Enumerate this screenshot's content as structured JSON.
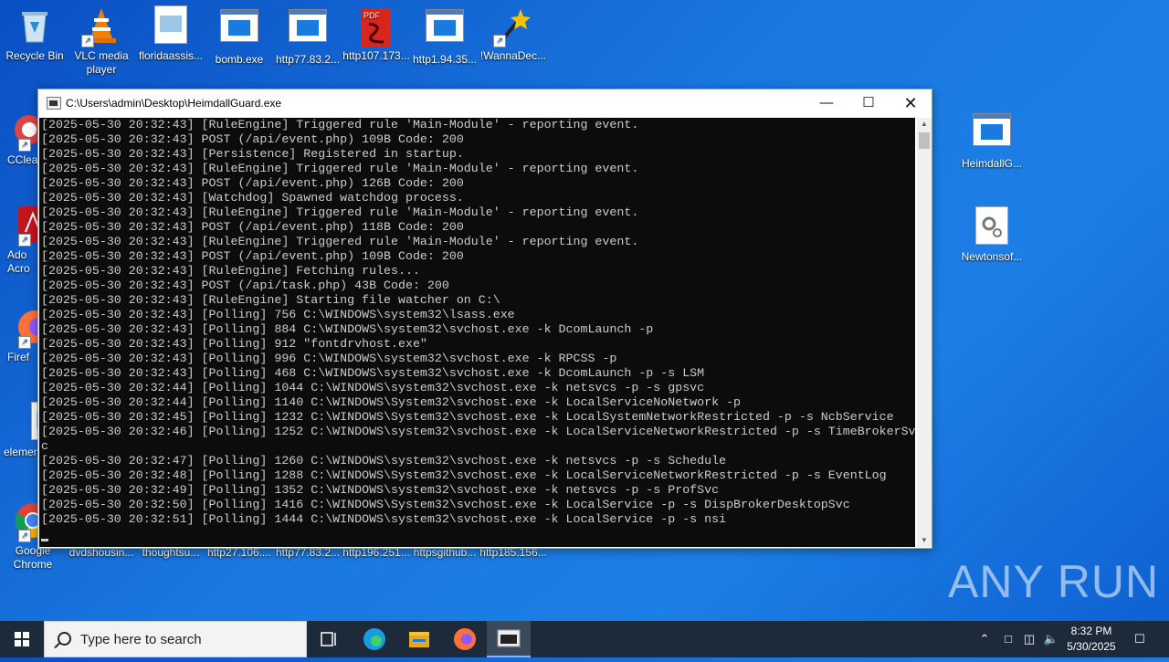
{
  "desktop_icons_top": [
    {
      "name": "recycle-bin-icon",
      "label": "Recycle Bin"
    },
    {
      "name": "vlc-icon",
      "label": "VLC media player"
    },
    {
      "name": "floridaassis-icon",
      "label": "floridaassis..."
    },
    {
      "name": "bomb-exe-icon",
      "label": "bomb.exe"
    },
    {
      "name": "http77-icon",
      "label": "http77.83.2..."
    },
    {
      "name": "http107-icon",
      "label": "http107.173..."
    },
    {
      "name": "http1-icon",
      "label": "http1.94.35..."
    },
    {
      "name": "wannadec-icon",
      "label": "!WannaDec..."
    }
  ],
  "desktop_icons_left": [
    {
      "name": "ccleaner-icon",
      "label": "CClea"
    },
    {
      "name": "adobe-icon",
      "label": "Ado Acro"
    },
    {
      "name": "firefox-desktop-icon",
      "label": "Firef"
    },
    {
      "name": "element-icon",
      "label": "elemen"
    },
    {
      "name": "chrome-icon",
      "label": "Google Chrome"
    }
  ],
  "desktop_icons_bottom": [
    {
      "name": "dvdshousin-icon",
      "label": "dvdshousin..."
    },
    {
      "name": "thoughtsu-icon",
      "label": "thoughtsu..."
    },
    {
      "name": "http27-icon",
      "label": "http27.106...."
    },
    {
      "name": "http77b-icon",
      "label": "http77.83.2..."
    },
    {
      "name": "http196-icon",
      "label": "http196.251..."
    },
    {
      "name": "httpsgithub-icon",
      "label": "httpsgithub..."
    },
    {
      "name": "http185-icon",
      "label": "http185.156..."
    }
  ],
  "desktop_icons_right": [
    {
      "name": "heimdall-desktop-icon",
      "label": "HeimdallG..."
    },
    {
      "name": "newtonsof-icon",
      "label": "Newtonsof..."
    }
  ],
  "console": {
    "title": "C:\\Users\\admin\\Desktop\\HeimdallGuard.exe",
    "lines": [
      "[2025-05-30 20:32:43] [RuleEngine] Triggered rule 'Main-Module' - reporting event.",
      "[2025-05-30 20:32:43] POST (/api/event.php) 109B Code: 200",
      "[2025-05-30 20:32:43] [Persistence] Registered in startup.",
      "[2025-05-30 20:32:43] [RuleEngine] Triggered rule 'Main-Module' - reporting event.",
      "[2025-05-30 20:32:43] POST (/api/event.php) 126B Code: 200",
      "[2025-05-30 20:32:43] [Watchdog] Spawned watchdog process.",
      "[2025-05-30 20:32:43] [RuleEngine] Triggered rule 'Main-Module' - reporting event.",
      "[2025-05-30 20:32:43] POST (/api/event.php) 118B Code: 200",
      "[2025-05-30 20:32:43] [RuleEngine] Triggered rule 'Main-Module' - reporting event.",
      "[2025-05-30 20:32:43] POST (/api/event.php) 109B Code: 200",
      "[2025-05-30 20:32:43] [RuleEngine] Fetching rules...",
      "[2025-05-30 20:32:43] POST (/api/task.php) 43B Code: 200",
      "[2025-05-30 20:32:43] [RuleEngine] Starting file watcher on C:\\",
      "[2025-05-30 20:32:43] [Polling] 756 C:\\WINDOWS\\system32\\lsass.exe",
      "[2025-05-30 20:32:43] [Polling] 884 C:\\WINDOWS\\system32\\svchost.exe -k DcomLaunch -p",
      "[2025-05-30 20:32:43] [Polling] 912 \"fontdrvhost.exe\"",
      "[2025-05-30 20:32:43] [Polling] 996 C:\\WINDOWS\\system32\\svchost.exe -k RPCSS -p",
      "[2025-05-30 20:32:43] [Polling] 468 C:\\WINDOWS\\system32\\svchost.exe -k DcomLaunch -p -s LSM",
      "[2025-05-30 20:32:44] [Polling] 1044 C:\\WINDOWS\\system32\\svchost.exe -k netsvcs -p -s gpsvc",
      "[2025-05-30 20:32:44] [Polling] 1140 C:\\WINDOWS\\System32\\svchost.exe -k LocalServiceNoNetwork -p",
      "[2025-05-30 20:32:45] [Polling] 1232 C:\\WINDOWS\\System32\\svchost.exe -k LocalSystemNetworkRestricted -p -s NcbService",
      "[2025-05-30 20:32:46] [Polling] 1252 C:\\WINDOWS\\system32\\svchost.exe -k LocalServiceNetworkRestricted -p -s TimeBrokerSv",
      "c",
      "[2025-05-30 20:32:47] [Polling] 1260 C:\\WINDOWS\\system32\\svchost.exe -k netsvcs -p -s Schedule",
      "[2025-05-30 20:32:48] [Polling] 1288 C:\\WINDOWS\\System32\\svchost.exe -k LocalServiceNetworkRestricted -p -s EventLog",
      "[2025-05-30 20:32:49] [Polling] 1352 C:\\WINDOWS\\system32\\svchost.exe -k netsvcs -p -s ProfSvc",
      "[2025-05-30 20:32:50] [Polling] 1416 C:\\WINDOWS\\System32\\svchost.exe -k LocalService -p -s DispBrokerDesktopSvc",
      "[2025-05-30 20:32:51] [Polling] 1444 C:\\WINDOWS\\system32\\svchost.exe -k LocalService -p -s nsi"
    ]
  },
  "taskbar": {
    "search_placeholder": "Type here to search",
    "time": "8:32 PM",
    "date": "5/30/2025"
  },
  "watermark": "ANY RUN"
}
